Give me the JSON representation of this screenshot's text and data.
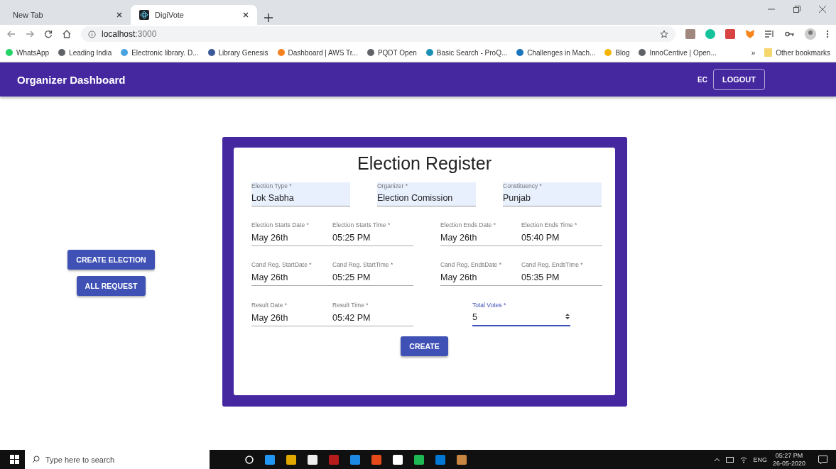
{
  "browser": {
    "tabs": [
      {
        "label": "New Tab",
        "selected": false
      },
      {
        "label": "DigiVote",
        "selected": true
      }
    ],
    "url": {
      "host": "localhost",
      "port": ":3000"
    },
    "bookmarks": [
      {
        "label": "WhatsApp",
        "color": "#25d366"
      },
      {
        "label": "Leading India",
        "color": "#5f6368"
      },
      {
        "label": "Electronic library. D...",
        "color": "#4aa3df"
      },
      {
        "label": "Library Genesis",
        "color": "#3b5998"
      },
      {
        "label": "Dashboard | AWS Tr...",
        "color": "#f58220"
      },
      {
        "label": "PQDT Open",
        "color": "#5f6368"
      },
      {
        "label": "Basic Search - ProQ...",
        "color": "#1a8fb3"
      },
      {
        "label": "Challenges in Mach...",
        "color": "#1b75bb"
      },
      {
        "label": "Blog",
        "color": "#f4b400"
      },
      {
        "label": "InnoCentive | Open...",
        "color": "#5f6368"
      }
    ],
    "more": "»",
    "other_bookmarks": "Other bookmarks"
  },
  "app_bar": {
    "title": "Organizer Dashboard",
    "user": "EC",
    "logout": "LOGOUT"
  },
  "sidebar": [
    "CREATE ELECTION",
    "ALL REQUEST"
  ],
  "form": {
    "title": "Election Register",
    "top_fields": [
      {
        "label": "Election Type *",
        "value": "Lok Sabha"
      },
      {
        "label": "Organizer *",
        "value": "Election Comission"
      },
      {
        "label": "Constituency *",
        "value": "Punjab"
      }
    ],
    "picker_rows": [
      [
        {
          "date_label": "Election Starts Date *",
          "date": "May 26th",
          "time_label": "Election Starts Time *",
          "time": "05:25 PM"
        },
        {
          "date_label": "Election Ends Date *",
          "date": "May 26th",
          "time_label": "Election Ends Time *",
          "time": "05:40 PM"
        }
      ],
      [
        {
          "date_label": "Cand Reg. StartDate *",
          "date": "May 26th",
          "time_label": "Cand Reg. StartTime *",
          "time": "05:25 PM"
        },
        {
          "date_label": "Cand Reg. EndsDate *",
          "date": "May 26th",
          "time_label": "Cand Reg. EndsTime *",
          "time": "05:35 PM"
        }
      ],
      [
        {
          "date_label": "Result Date *",
          "date": "May 26th",
          "time_label": "Result Time *",
          "time": "05:42 PM"
        }
      ]
    ],
    "total_votes": {
      "label": "Total Votes *",
      "value": "5",
      "focused": true
    },
    "submit": "CREATE"
  },
  "taskbar": {
    "search_placeholder": "Type here to search",
    "language": "ENG",
    "time": "05:27 PM",
    "date": "26-05-2020"
  }
}
